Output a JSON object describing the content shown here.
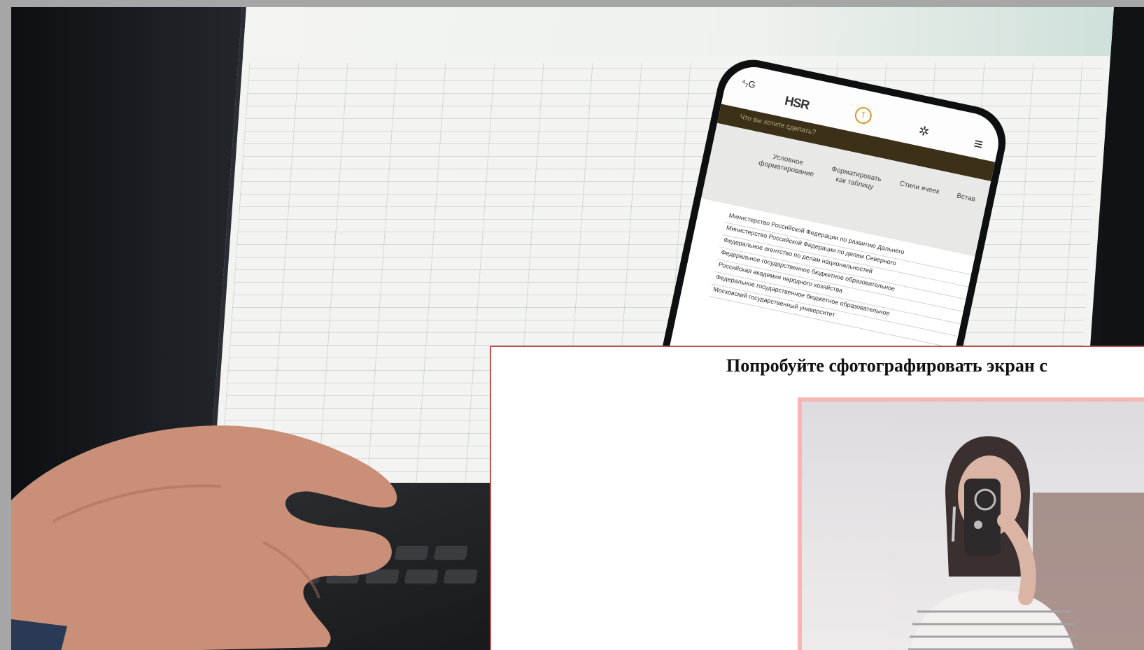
{
  "overlay": {
    "title": "Попробуйте сфотографировать экран с"
  },
  "phone": {
    "status": "⁴₇G",
    "logo": "HSR",
    "circle_label": "T",
    "search_placeholder": "Что вы хотите сделать?",
    "ribbon": [
      {
        "label": "Условное форматирование"
      },
      {
        "label": "Форматировать как таблицу"
      },
      {
        "label": "Стили ячеек"
      },
      {
        "label": "Встав"
      }
    ],
    "rows": [
      "Министерство Российской Федерации по развитию Дальнего",
      "Министерство Российской Федерации по делам Северного",
      "Федеральное агентство по делам национальностей",
      "Федеральное государственное бюджетное образовательное",
      "Российская академия народного хозяйства",
      "Федеральное государственное бюджетное образовательное",
      "Московский государственный университет"
    ]
  },
  "icons": {
    "phone_icons": [
      "signal-icon",
      "timer-icon",
      "bell-icon",
      "hamburger-menu-icon"
    ]
  }
}
